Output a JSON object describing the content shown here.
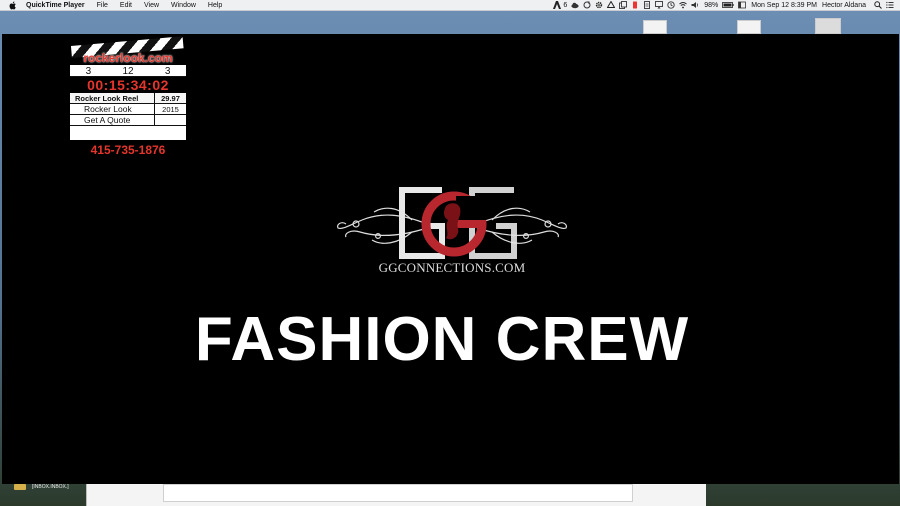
{
  "menubar": {
    "app_name": "QuickTime Player",
    "menus": [
      "File",
      "Edit",
      "View",
      "Window",
      "Help"
    ],
    "status_number": "6",
    "battery": "98%",
    "datetime": "Mon Sep 12  8:39 PM",
    "user": "Hector Aldana"
  },
  "background": {
    "inbox_label": "[INBOX.INBOX.]"
  },
  "clapboard": {
    "site": "rockerlook.com",
    "numbers": [
      "3",
      "12",
      "3"
    ],
    "timecode": "00:15:34:02",
    "reel_label": "Rocker Look Reel",
    "reel_value": "29.97",
    "title": "Rocker Look",
    "year": "2015",
    "cta": "Get A Quote",
    "phone": "415-735-1876"
  },
  "logo": {
    "wordmark": "GGCONNECTIONS.COM",
    "accent_color": "#b8272e"
  },
  "headline": "FASHION CREW"
}
